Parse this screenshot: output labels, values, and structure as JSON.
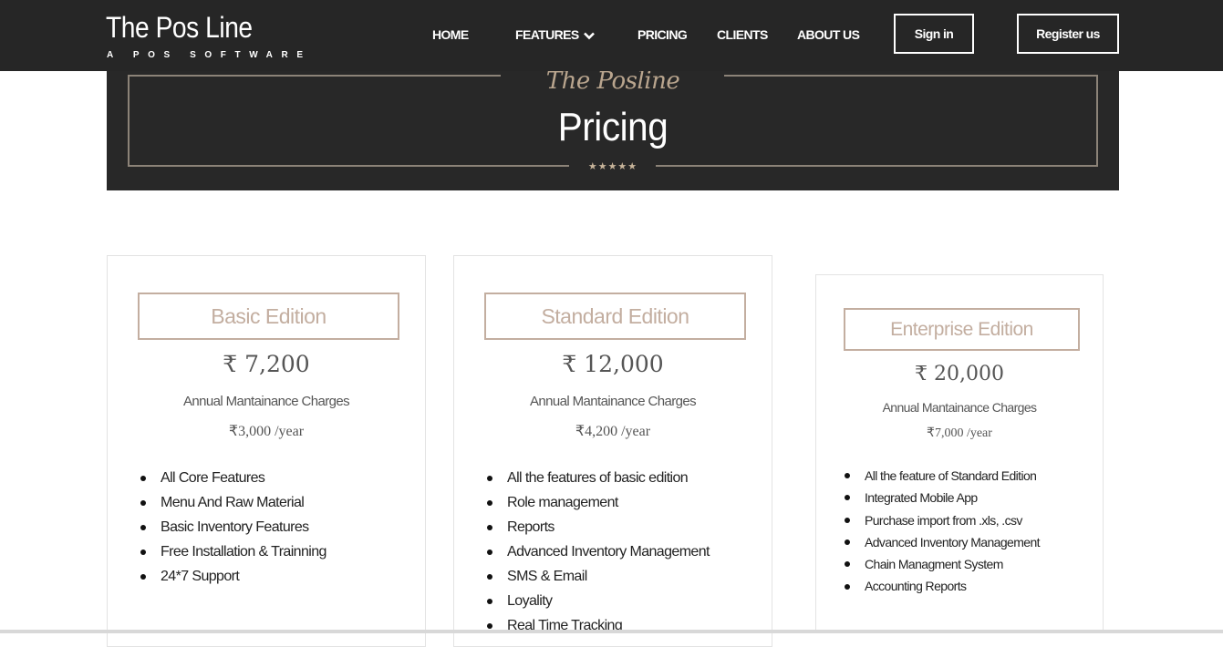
{
  "brand": {
    "title": "The Pos Line",
    "subtitle": "A POS SOFTWARE"
  },
  "nav": {
    "home": "HOME",
    "features": "FEATURES",
    "pricing": "PRICING",
    "clients": "CLIENTS",
    "about": "ABOUT US",
    "sign_in": "Sign in",
    "register": "Register us"
  },
  "hero": {
    "script": "The Posline",
    "title": "Pricing",
    "stars": "★★★★★"
  },
  "plans": [
    {
      "name": "Basic Edition",
      "price": "₹ 7,200",
      "amc_label": "Annual Mantainance Charges",
      "amc_value": "₹3,000 /year",
      "features": [
        "All Core Features",
        "Menu And Raw Material",
        "Basic Inventory Features",
        "Free Installation & Trainning",
        "24*7 Support"
      ]
    },
    {
      "name": "Standard Edition",
      "price": "₹ 12,000",
      "amc_label": "Annual Mantainance Charges",
      "amc_value": "₹4,200 /year",
      "features": [
        "All the features of basic edition",
        "Role management",
        "Reports",
        "Advanced Inventory Management",
        "SMS & Email",
        "Loyality",
        "Real Time Tracking"
      ]
    },
    {
      "name": "Enterprise Edition",
      "price": "₹ 20,000",
      "amc_label": "Annual Mantainance Charges",
      "amc_value": "₹7,000 /year",
      "features": [
        "All the feature of Standard Edition",
        "Integrated Mobile App",
        "Purchase import from .xls, .csv",
        "Advanced Inventory Management",
        "Chain Managment System",
        "Accounting Reports"
      ]
    }
  ],
  "colors": {
    "header_bg": "#262626",
    "hero_bg": "#282828",
    "accent": "#c3aea0",
    "script": "#b9a58e"
  }
}
